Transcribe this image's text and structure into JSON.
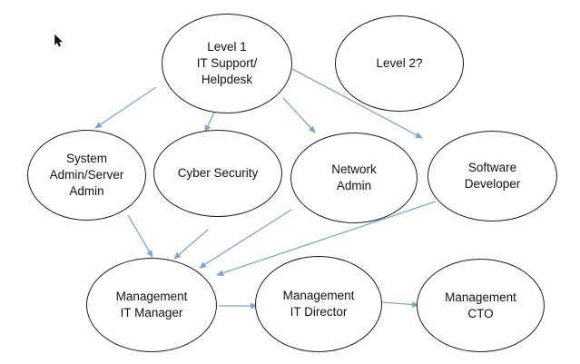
{
  "diagram": {
    "nodes": [
      {
        "id": "level1",
        "label": "Level 1\nIT Support/\nHelpdesk"
      },
      {
        "id": "level2",
        "label": "Level 2?"
      },
      {
        "id": "sysadmin",
        "label": "System\nAdmin/Server\nAdmin"
      },
      {
        "id": "cyber",
        "label": "Cyber Security"
      },
      {
        "id": "network",
        "label": "Network\nAdmin"
      },
      {
        "id": "software",
        "label": "Software\nDeveloper"
      },
      {
        "id": "it_manager",
        "label": "Management\nIT Manager"
      },
      {
        "id": "it_director",
        "label": "Management\nIT Director"
      },
      {
        "id": "cto",
        "label": "Management\nCTO"
      }
    ],
    "edges": [
      {
        "from": "level1",
        "to": "sysadmin"
      },
      {
        "from": "level1",
        "to": "cyber"
      },
      {
        "from": "level1",
        "to": "network"
      },
      {
        "from": "level1",
        "to": "software"
      },
      {
        "from": "sysadmin",
        "to": "it_manager"
      },
      {
        "from": "cyber",
        "to": "it_manager"
      },
      {
        "from": "network",
        "to": "it_manager"
      },
      {
        "from": "software",
        "to": "it_manager"
      },
      {
        "from": "it_manager",
        "to": "it_director"
      },
      {
        "from": "it_director",
        "to": "cto"
      }
    ],
    "arrow_color": "#7ea6cf",
    "node_border_color": "#1c1c1c"
  },
  "cursor": {
    "icon": "mouse-pointer-icon"
  }
}
